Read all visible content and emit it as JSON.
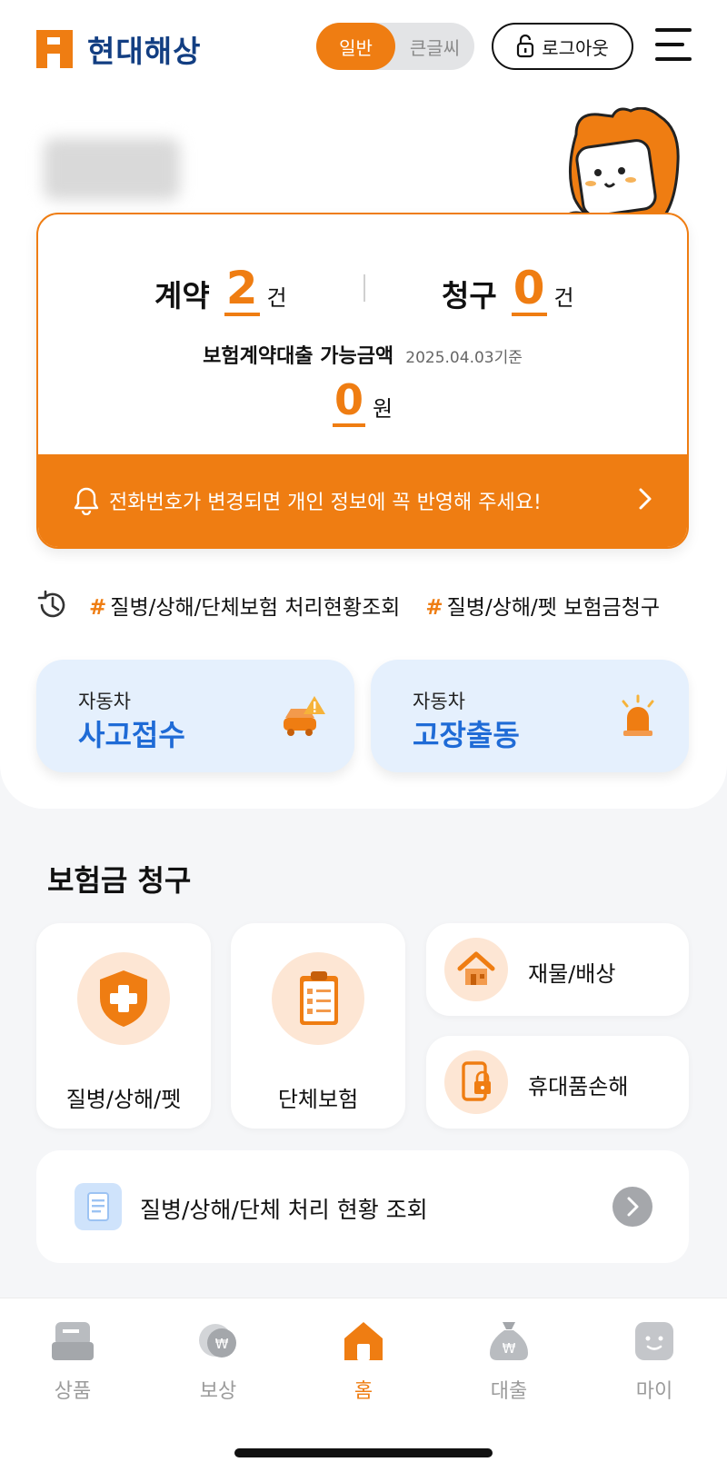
{
  "header": {
    "brand": "현대해상",
    "mode_toggle": {
      "options": [
        "일반",
        "큰글씨"
      ],
      "selected": "일반"
    },
    "logout_label": "로그아웃"
  },
  "summary": {
    "contract_label": "계약",
    "contract_count": "2",
    "claim_label": "청구",
    "claim_count": "0",
    "count_unit": "건",
    "loan_label": "보험계약대출 가능금액",
    "loan_date": "2025.04.03기준",
    "loan_amount": "0",
    "loan_unit": "원",
    "notice": "전화번호가 변경되면 개인 정보에 꼭 반영해 주세요!"
  },
  "recent_links": [
    {
      "hash": "#",
      "label": "질병/상해/단체보험 처리현황조회"
    },
    {
      "hash": "#",
      "label": "질병/상해/펫 보험금청구"
    }
  ],
  "auto_buttons": [
    {
      "small": "자동차",
      "big": "사고접수",
      "icon": "car-accident-icon"
    },
    {
      "small": "자동차",
      "big": "고장출동",
      "icon": "siren-icon"
    }
  ],
  "claims": {
    "title": "보험금 청구",
    "tiles": [
      {
        "label": "질병/상해/펫",
        "icon": "medical-shield-icon"
      },
      {
        "label": "단체보험",
        "icon": "clipboard-icon"
      },
      {
        "label": "재물/배상",
        "icon": "house-icon"
      },
      {
        "label": "휴대품손해",
        "icon": "phone-lock-icon"
      }
    ],
    "status_label": "질병/상해/단체 처리 현황 조회"
  },
  "bottom_nav": {
    "items": [
      {
        "label": "상품",
        "icon": "product-icon"
      },
      {
        "label": "보상",
        "icon": "compensation-icon"
      },
      {
        "label": "홈",
        "icon": "home-icon"
      },
      {
        "label": "대출",
        "icon": "loan-bag-icon"
      },
      {
        "label": "마이",
        "icon": "my-face-icon"
      }
    ],
    "active": "홈"
  },
  "colors": {
    "accent": "#ef7d12",
    "brand_navy": "#123e82",
    "auto_blue": "#1f6bd6"
  }
}
